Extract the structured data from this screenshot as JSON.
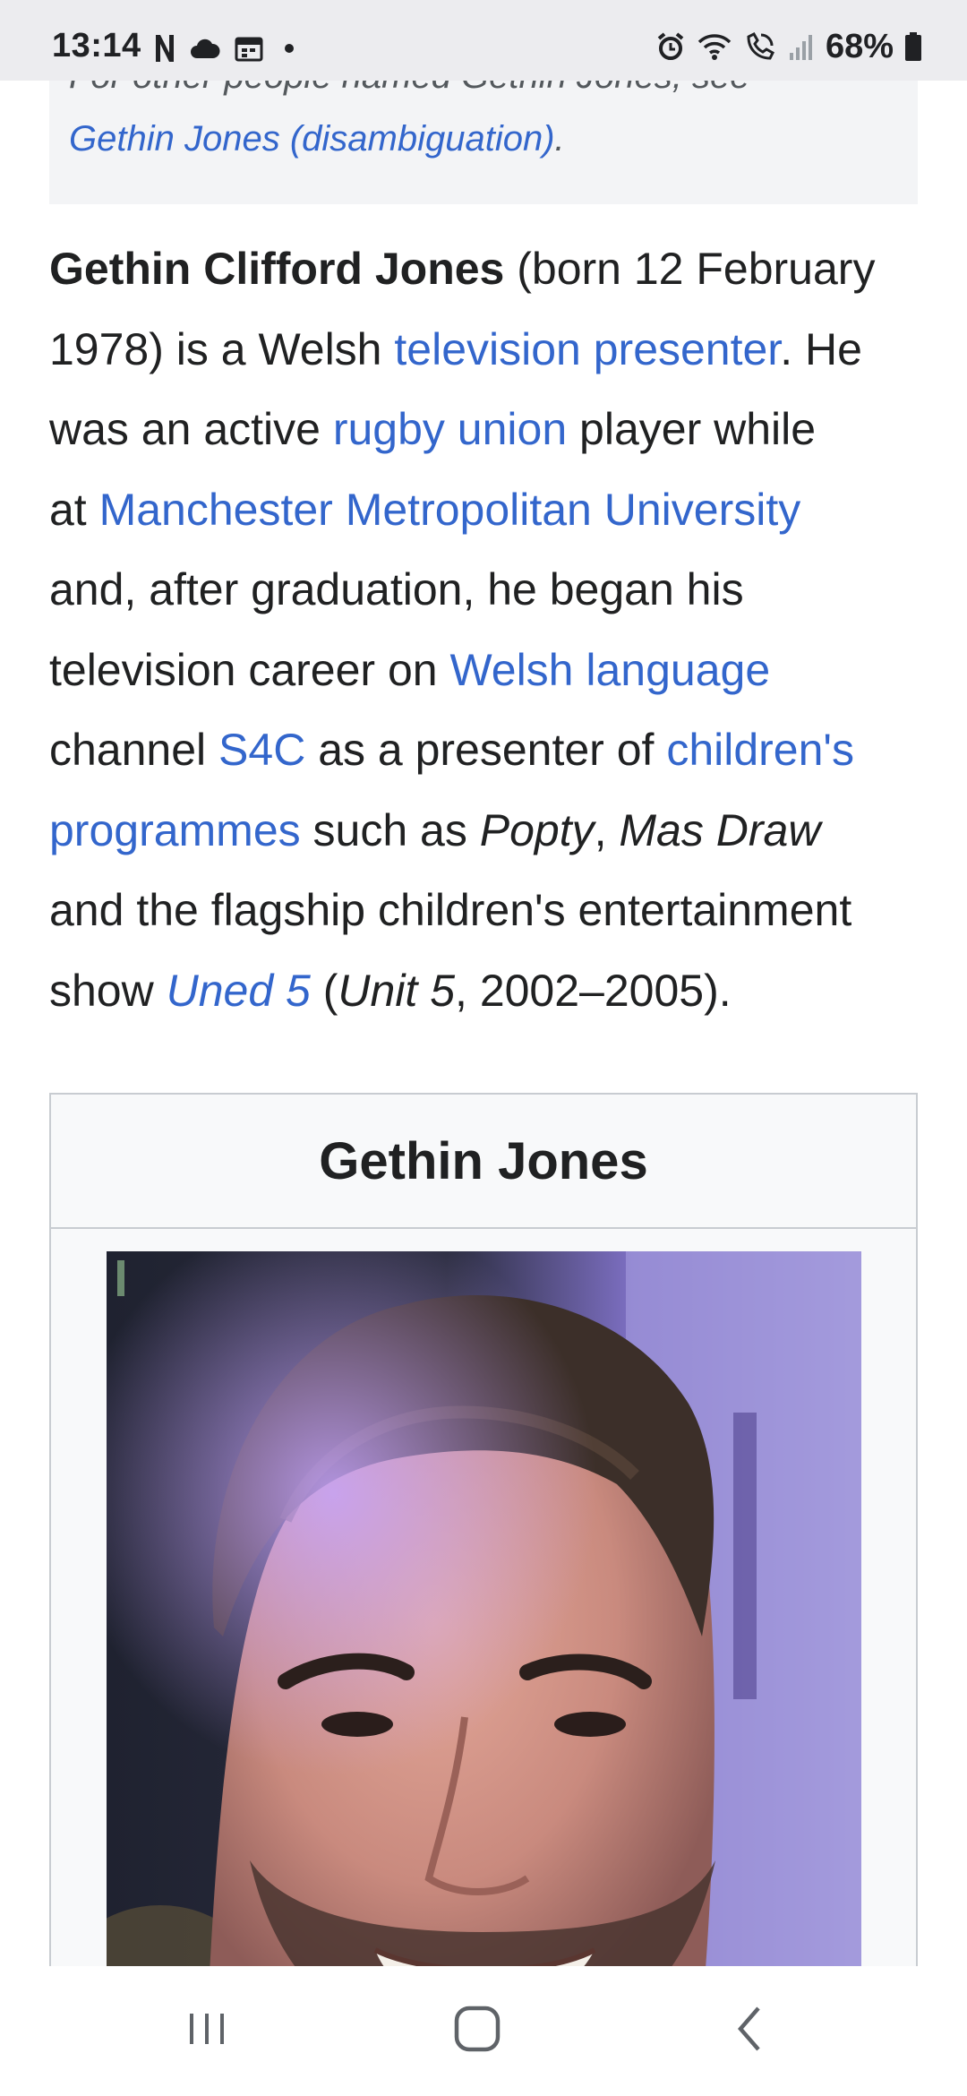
{
  "status_bar": {
    "time": "13:14",
    "battery": "68%",
    "left_icons": [
      "netflix-icon",
      "cloud-icon",
      "calendar-icon",
      "dot-icon"
    ],
    "right_icons": [
      "alarm-icon",
      "wifi-icon",
      "wifi-calling-icon",
      "signal-icon",
      "battery-icon"
    ]
  },
  "hatnote": {
    "text": "For other people named Gethin Jones, see",
    "link": "Gethin Jones (disambiguation)",
    "end": "."
  },
  "article": {
    "lines": [
      [
        {
          "t": "Gethin Clifford Jones",
          "s": "b"
        },
        {
          "t": " (born 12 February"
        }
      ],
      [
        {
          "t": "1978) is a Welsh "
        },
        {
          "t": "television presenter",
          "s": "a"
        },
        {
          "t": ". He"
        }
      ],
      [
        {
          "t": "was an active "
        },
        {
          "t": "rugby union",
          "s": "a"
        },
        {
          "t": " player while"
        }
      ],
      [
        {
          "t": "at "
        },
        {
          "t": "Manchester Metropolitan University",
          "s": "a"
        }
      ],
      [
        {
          "t": "and, after graduation, he began his"
        }
      ],
      [
        {
          "t": "television career on "
        },
        {
          "t": "Welsh language",
          "s": "a"
        }
      ],
      [
        {
          "t": "channel "
        },
        {
          "t": "S4C",
          "s": "a"
        },
        {
          "t": " as a presenter of "
        },
        {
          "t": "children's",
          "s": "a"
        }
      ],
      [
        {
          "t": "programmes",
          "s": "a"
        },
        {
          "t": " such as "
        },
        {
          "t": "Popty",
          "s": "i"
        },
        {
          "t": ", "
        },
        {
          "t": "Mas Draw",
          "s": "i"
        }
      ],
      [
        {
          "t": "and the flagship children's entertainment"
        }
      ],
      [
        {
          "t": "show "
        },
        {
          "t": "Uned 5",
          "s": "ai"
        },
        {
          "t": " ("
        },
        {
          "t": "Unit 5",
          "s": "i"
        },
        {
          "t": ", 2002–2005)."
        }
      ]
    ]
  },
  "infobox": {
    "title": "Gethin Jones"
  },
  "nav_bar": {
    "buttons": [
      "recent-apps-button",
      "home-button",
      "back-button"
    ]
  },
  "colors": {
    "link": "#3366cc",
    "text": "#202122",
    "status_bar_bg": "#ececef",
    "hatnote_bg": "#f3f4f6",
    "infobox_border": "#c8ccd1"
  }
}
